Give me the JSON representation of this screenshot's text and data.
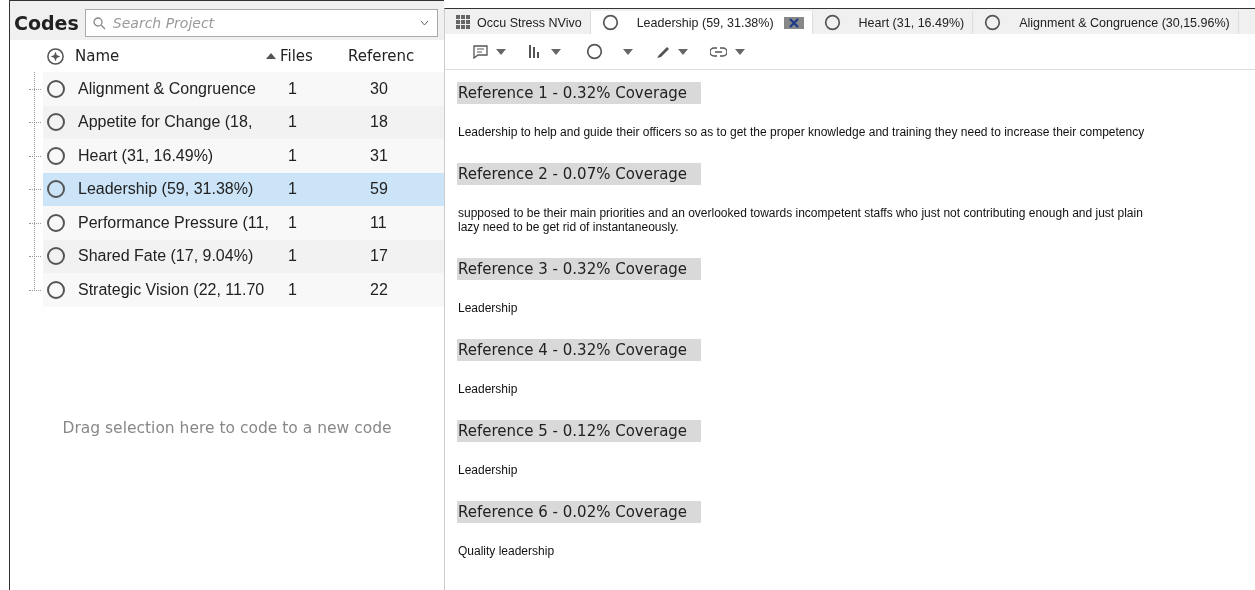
{
  "codes_panel": {
    "title": "Codes",
    "search": {
      "placeholder": "Search Project"
    },
    "columns": [
      "Name",
      "Files",
      "Referenc"
    ],
    "rows": [
      {
        "name": "Alignment & Congruence",
        "files": "1",
        "references": "30",
        "selected": false
      },
      {
        "name": "Appetite for Change  (18,",
        "files": "1",
        "references": "18",
        "selected": false
      },
      {
        "name": "Heart (31, 16.49%)",
        "files": "1",
        "references": "31",
        "selected": false
      },
      {
        "name": "Leadership (59, 31.38%)",
        "files": "1",
        "references": "59",
        "selected": true
      },
      {
        "name": "Performance Pressure (11,",
        "files": "1",
        "references": "11",
        "selected": false
      },
      {
        "name": "Shared Fate (17, 9.04%)",
        "files": "1",
        "references": "17",
        "selected": false
      },
      {
        "name": "Strategic Vision (22, 11.70",
        "files": "1",
        "references": "22",
        "selected": false
      }
    ],
    "drop_hint": "Drag selection here to code to a new code"
  },
  "tabs": [
    {
      "label": "Occu Stress NVivo",
      "kind": "project",
      "selected": false
    },
    {
      "label": "Leadership (59, 31.38%)",
      "kind": "code",
      "selected": true
    },
    {
      "label": "Heart (31, 16.49%)",
      "kind": "code",
      "selected": false
    },
    {
      "label": "Alignment & Congruence (30,15.96%)",
      "kind": "code",
      "selected": false
    }
  ],
  "references": [
    {
      "heading": "Reference 1 - 0.32% Coverage",
      "text": "Leadership to help and guide their officers so as to get the proper knowledge and training they need to increase their competency"
    },
    {
      "heading": "Reference 2 - 0.07% Coverage",
      "text": "supposed to be their main priorities and an overlooked towards incompetent staffs who just not contributing enough and just plain lazy need to be get rid of instantaneously."
    },
    {
      "heading": "Reference 3 - 0.32% Coverage",
      "text": "Leadership"
    },
    {
      "heading": "Reference 4 - 0.32% Coverage",
      "text": "Leadership"
    },
    {
      "heading": "Reference 5 - 0.12% Coverage",
      "text": "Leadership"
    },
    {
      "heading": "Reference 6 - 0.02% Coverage",
      "text": "Quality leadership"
    }
  ]
}
